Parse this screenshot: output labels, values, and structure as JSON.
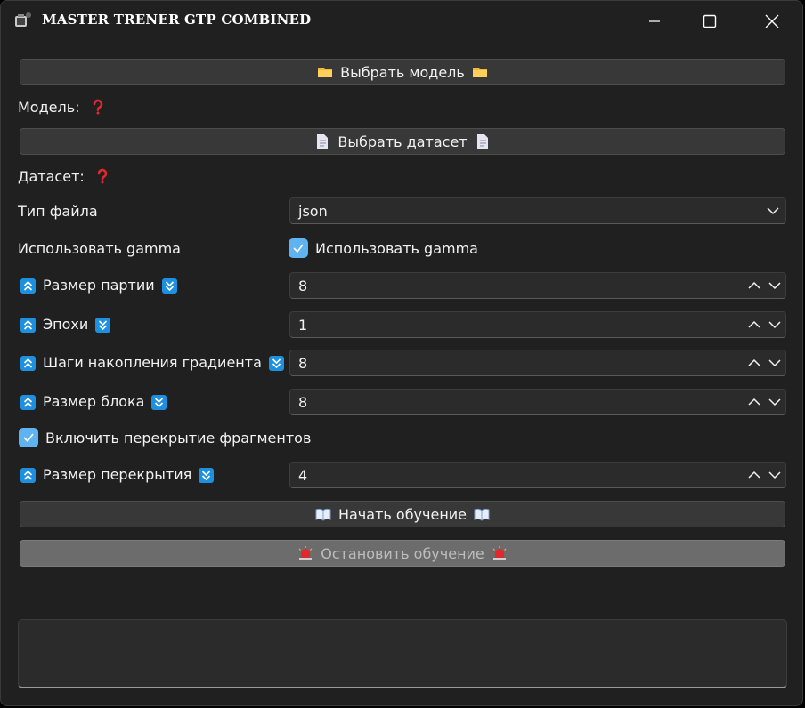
{
  "window": {
    "title": "MASTER TRENER GTP COMBINED",
    "icons": {
      "app": "book-bag-icon",
      "minimize": "minimize-icon",
      "maximize": "maximize-icon",
      "close": "close-icon"
    }
  },
  "model": {
    "button_label": "Выбрать модель",
    "button_icon": "folder-icon",
    "label": "Модель:",
    "status_icon": "question-mark-icon"
  },
  "dataset": {
    "button_label": "Выбрать датасет",
    "button_icon": "document-icon",
    "label": "Датасет:",
    "status_icon": "question-mark-icon"
  },
  "file_type": {
    "label": "Тип файла",
    "value": "json"
  },
  "gamma": {
    "label": "Использовать gamma",
    "checkbox_label": "Использовать gamma",
    "checked": true
  },
  "batch_size": {
    "label": "Размер партии",
    "value": "8"
  },
  "epochs": {
    "label": "Эпохи",
    "value": "1"
  },
  "grad_accum": {
    "label": "Шаги накопления градиента",
    "value": "8"
  },
  "block_size": {
    "label": "Размер блока",
    "value": "8"
  },
  "overlap_enable": {
    "label": "Включить перекрытие фрагментов",
    "checked": true
  },
  "overlap_size": {
    "label": "Размер перекрытия",
    "value": "4"
  },
  "start": {
    "label": "Начать обучение",
    "icon": "open-book-icon"
  },
  "stop": {
    "label": "Остановить обучение",
    "icon": "siren-icon",
    "enabled": false
  },
  "log": {
    "text": ""
  },
  "colors": {
    "accent": "#5fb3f0",
    "arrow_badge": "#1e90e0",
    "question": "#e0282e",
    "folder": "#f5b73a"
  }
}
